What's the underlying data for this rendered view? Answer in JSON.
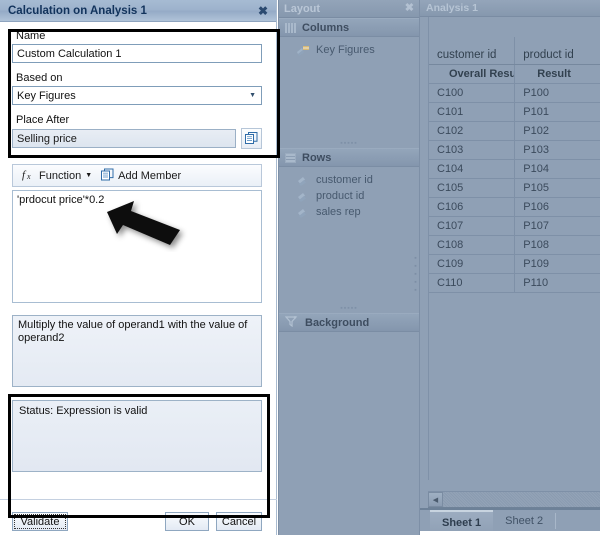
{
  "dialog": {
    "title": "Calculation on Analysis 1",
    "close_icon": "close-icon",
    "name_label": "Name",
    "name_value": "Custom Calculation 1",
    "based_on_label": "Based on",
    "based_on_value": "Key Figures",
    "based_on_options": [
      "Key Figures"
    ],
    "place_after_label": "Place After",
    "place_after_value": "Selling price",
    "place_after_picker_icon": "member-picker-icon",
    "toolbar": {
      "function_label": "Function",
      "function_icon": "fx-icon",
      "function_caret": "▾",
      "add_member_label": "Add Member",
      "add_member_icon": "add-member-icon"
    },
    "formula": "'prdocut price'*0.2",
    "description": "Multiply the value of operand1 with the value of operand2",
    "status": "Status: Expression is valid",
    "buttons": {
      "validate": "Validate",
      "ok": "OK",
      "cancel": "Cancel"
    }
  },
  "layout_panel": {
    "title": "Layout",
    "close_icon": "close-icon",
    "sections": [
      {
        "name": "Columns",
        "icon": "columns-icon",
        "items": [
          {
            "label": "Key Figures",
            "icon": "key-figures-icon"
          }
        ]
      },
      {
        "name": "Rows",
        "icon": "rows-icon",
        "items": [
          {
            "label": "customer id",
            "icon": "dimension-icon"
          },
          {
            "label": "product id",
            "icon": "dimension-icon"
          },
          {
            "label": "sales rep",
            "icon": "dimension-icon"
          }
        ]
      },
      {
        "name": "Background",
        "icon": "filter-icon",
        "items": []
      }
    ]
  },
  "analysis_panel": {
    "title": "Analysis 1",
    "columns": [
      "customer id",
      "product id"
    ],
    "result_row": [
      "Overall Result",
      "Result"
    ],
    "rows": [
      [
        "C100",
        "P100"
      ],
      [
        "C101",
        "P101"
      ],
      [
        "C102",
        "P102"
      ],
      [
        "C103",
        "P103"
      ],
      [
        "C104",
        "P104"
      ],
      [
        "C105",
        "P105"
      ],
      [
        "C106",
        "P106"
      ],
      [
        "C107",
        "P107"
      ],
      [
        "C108",
        "P108"
      ],
      [
        "C109",
        "P109"
      ],
      [
        "C110",
        "P110"
      ]
    ],
    "scroll_left_icon": "scroll-left-arrow-icon",
    "sheets": [
      {
        "label": "Sheet 1",
        "active": true
      },
      {
        "label": "Sheet 2",
        "active": false
      }
    ]
  },
  "annotations": {
    "pointer_icon": "mouse-pointer-arrow",
    "highlight_count": 2
  },
  "colors": {
    "dialog_title_bar": "#9db2cc",
    "panel_background": "#8fa0b5",
    "highlight_box": "#000000",
    "grid_text": "#3b4a5c"
  }
}
